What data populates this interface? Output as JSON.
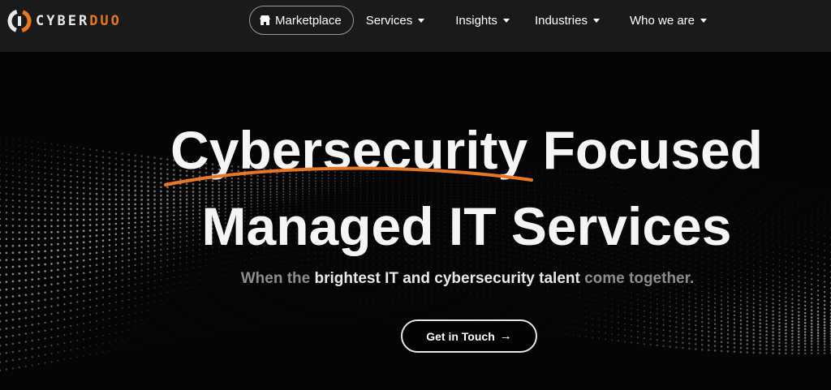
{
  "brand": {
    "logo_white": "CYBER",
    "logo_orange": "DUO",
    "colors": {
      "accent": "#e87722",
      "header_bg": "#1a1a1a",
      "hero_bg": "#050505",
      "text": "#ffffff"
    }
  },
  "nav": {
    "marketplace": {
      "label": "Marketplace",
      "icon": "store-icon"
    },
    "items": [
      {
        "label": "Services",
        "icon": "caret-down-icon"
      },
      {
        "label": "Insights",
        "icon": "caret-down-icon"
      },
      {
        "label": "Industries",
        "icon": "caret-down-icon"
      },
      {
        "label": "Who we are",
        "icon": "caret-down-icon"
      }
    ]
  },
  "hero": {
    "title_highlight": "Cybersecurity",
    "title_rest": " Focused",
    "title_line2": "Managed IT Services",
    "tagline_pre": "When the ",
    "tagline_highlight": "brightest IT and cybersecurity talent",
    "tagline_post": " come together.",
    "cta_label": "Get in Touch",
    "cta_icon": "arrow-right-icon"
  }
}
